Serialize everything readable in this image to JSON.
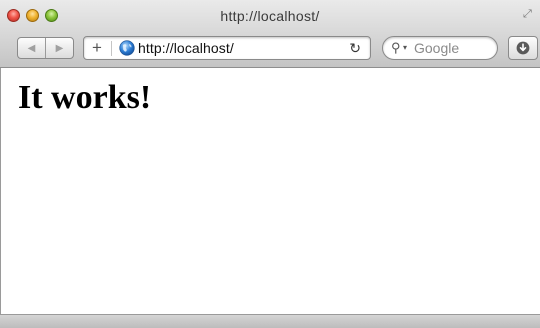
{
  "window": {
    "title": "http://localhost/"
  },
  "toolbar": {
    "url": "http://localhost/",
    "search_placeholder": "Google",
    "icons": [
      "back-arrow-icon",
      "forward-arrow-icon",
      "plus-icon",
      "globe-icon",
      "reload-icon",
      "search-icon",
      "download-icon"
    ]
  },
  "page": {
    "heading": "It works!"
  },
  "colors": {
    "chrome_top": "#eaeaea",
    "chrome_bottom": "#c4c4c4",
    "close": "#f0554a",
    "minimize": "#f0b331",
    "zoom": "#8ec63c",
    "globe": "#2e7fd6"
  }
}
